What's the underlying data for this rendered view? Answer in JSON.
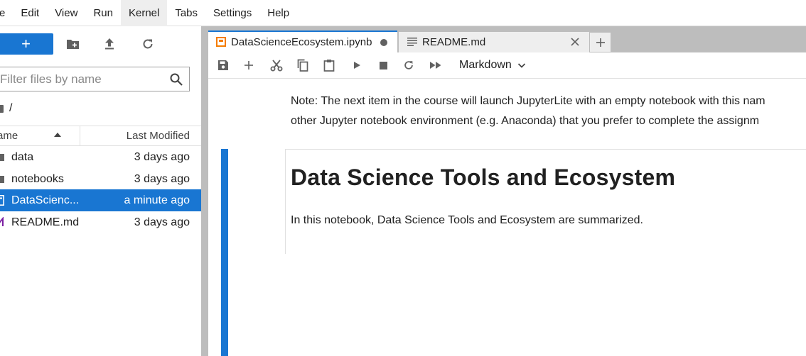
{
  "menu": {
    "items": [
      "e",
      "Edit",
      "View",
      "Run",
      "Kernel",
      "Tabs",
      "Settings",
      "Help"
    ],
    "active": "Kernel"
  },
  "filebrowser": {
    "new_label": "+",
    "filter_placeholder": "Filter files by name",
    "breadcrumb": "/",
    "col_name": "ame",
    "col_modified": "Last Modified",
    "files": [
      {
        "name": "data",
        "modified": "3 days ago",
        "icon": "folder-icon",
        "selected": false
      },
      {
        "name": "notebooks",
        "modified": "3 days ago",
        "icon": "folder-icon",
        "selected": false
      },
      {
        "name": "DataScienc...",
        "modified": "a minute ago",
        "icon": "notebook-icon",
        "selected": true
      },
      {
        "name": "README.md",
        "modified": "3 days ago",
        "icon": "markdown-icon",
        "selected": false
      }
    ]
  },
  "tabs": [
    {
      "label": "DataScienceEcosystem.ipynb",
      "icon": "notebook-icon",
      "active": true,
      "dirty": true
    },
    {
      "label": "README.md",
      "icon": "markdown-icon",
      "active": false,
      "dirty": false
    }
  ],
  "toolbar": {
    "cell_type": "Markdown"
  },
  "notebook": {
    "note_line1": "Note: The next item in the course will launch JupyterLite with an empty notebook with this nam",
    "note_line2": "other Jupyter notebook environment (e.g. Anaconda) that you prefer to complete the assignm",
    "heading": "Data Science Tools and Ecosystem",
    "paragraph": "In this notebook, Data Science Tools and Ecosystem are summarized."
  },
  "colors": {
    "accent": "#1976d2",
    "notebook_icon": "#f57c00",
    "markdown_icon": "#7b1fa2"
  }
}
